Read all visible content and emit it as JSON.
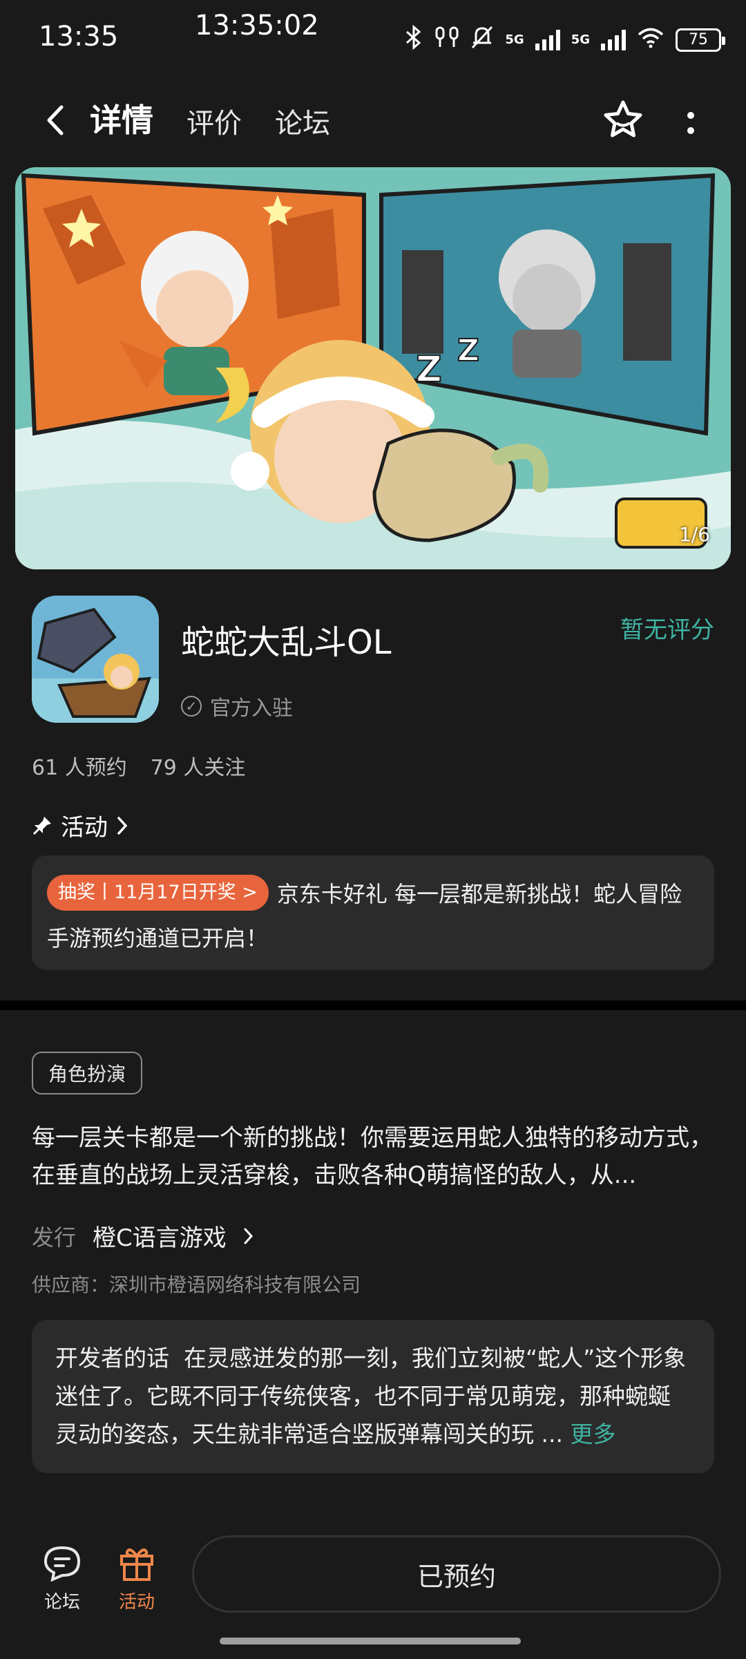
{
  "status_bar": {
    "time": "13:35",
    "clock": "13:35:02",
    "network_1": "5G",
    "network_2": "5G",
    "battery": "75"
  },
  "nav": {
    "tabs": [
      {
        "label": "详情",
        "active": true
      },
      {
        "label": "评价",
        "active": false
      },
      {
        "label": "论坛",
        "active": false
      }
    ]
  },
  "banner": {
    "counter": "1/6"
  },
  "app": {
    "name": "蛇蛇大乱斗OL",
    "official": "官方入驻",
    "rating": "暂无评分",
    "reservations": "61 人预约",
    "follows": "79 人关注"
  },
  "activity": {
    "heading": "活动",
    "badge": "抽奖丨11月17日开奖 >",
    "text": "京东卡好礼 每一层都是新挑战！蛇人冒险手游预约通道已开启！"
  },
  "details": {
    "tag": "角色扮演",
    "description": "每一层关卡都是一个新的挑战！你需要运用蛇人独特的移动方式，在垂直的战场上灵活穿梭，击败各种Q萌搞怪的敌人，从...",
    "publisher_label": "发行",
    "publisher": "橙C语言游戏",
    "supplier": "供应商：深圳市橙语网络科技有限公司",
    "developer_title": "开发者的话",
    "developer_text": "在灵感迸发的那一刻，我们立刻被“蛇人”这个形象迷住了。它既不同于传统侠客，也不同于常见萌宠，那种蜿蜒灵动的姿态，天生就非常适合竖版弹幕闯关的玩 ...",
    "more": "更多"
  },
  "bottom_bar": {
    "forum": "论坛",
    "activity": "活动",
    "reserve_button": "已预约"
  },
  "colors": {
    "accent": "#3fb3a2",
    "badge": "#e8643c",
    "activity_orange": "#f0874a",
    "background": "#1a1a1a",
    "card": "#2b2b2b"
  }
}
